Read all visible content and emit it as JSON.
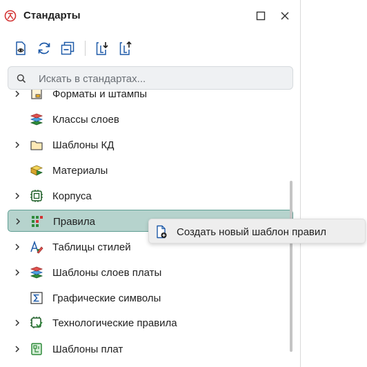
{
  "window": {
    "title": "Стандарты"
  },
  "search": {
    "placeholder": "Искать в стандартах..."
  },
  "tree": {
    "items": [
      {
        "label": "Форматы и штампы",
        "expandable": true
      },
      {
        "label": "Классы слоев",
        "expandable": false
      },
      {
        "label": "Шаблоны КД",
        "expandable": true
      },
      {
        "label": "Материалы",
        "expandable": false
      },
      {
        "label": "Корпуса",
        "expandable": true
      },
      {
        "label": "Правила",
        "expandable": true,
        "selected": true
      },
      {
        "label": "Таблицы стилей",
        "expandable": true
      },
      {
        "label": "Шаблоны слоев платы",
        "expandable": true
      },
      {
        "label": "Графические символы",
        "expandable": false
      },
      {
        "label": "Технологические правила",
        "expandable": true
      },
      {
        "label": "Шаблоны плат",
        "expandable": true
      }
    ]
  },
  "context_menu": {
    "items": [
      {
        "label": "Создать новый шаблон правил",
        "icon": "new-rules-template-icon"
      }
    ]
  },
  "colors": {
    "accent": "#5f9e93",
    "selected_bg": "#b6d3cd",
    "icon_blue": "#1e5aa8",
    "icon_green": "#2f8a3a",
    "icon_red": "#d23232"
  }
}
